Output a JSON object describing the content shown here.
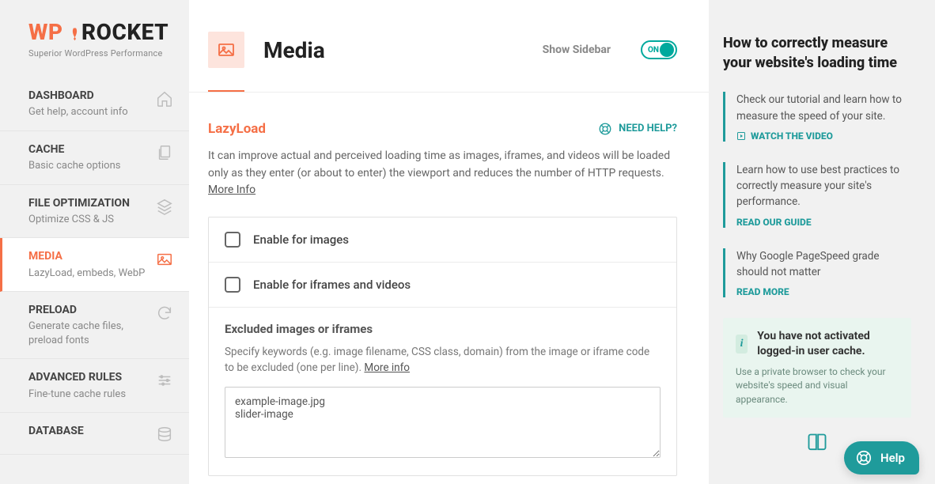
{
  "logo": {
    "prefix": "WP",
    "suffix": "ROCKET",
    "tagline": "Superior WordPress Performance"
  },
  "nav": [
    {
      "title": "DASHBOARD",
      "sub": "Get help, account info",
      "icon": "home"
    },
    {
      "title": "CACHE",
      "sub": "Basic cache options",
      "icon": "copy"
    },
    {
      "title": "FILE OPTIMIZATION",
      "sub": "Optimize CSS & JS",
      "icon": "layers"
    },
    {
      "title": "MEDIA",
      "sub": "LazyLoad, embeds, WebP",
      "icon": "image",
      "active": true
    },
    {
      "title": "PRELOAD",
      "sub": "Generate cache files, preload fonts",
      "icon": "refresh"
    },
    {
      "title": "ADVANCED RULES",
      "sub": "Fine-tune cache rules",
      "icon": "sliders"
    },
    {
      "title": "DATABASE",
      "sub": "",
      "icon": "database"
    }
  ],
  "header": {
    "title": "Media",
    "show_sidebar_label": "Show Sidebar",
    "toggle_on": "ON"
  },
  "section": {
    "title": "LazyLoad",
    "need_help": "NEED HELP?",
    "desc": "It can improve actual and perceived loading time as images, iframes, and videos will be loaded only as they enter (or about to enter) the viewport and reduces the number of HTTP requests.",
    "more_info": "More Info"
  },
  "options": {
    "enable_images": "Enable for images",
    "enable_iframes": "Enable for iframes and videos",
    "excluded_title": "Excluded images or iframes",
    "excluded_desc": "Specify keywords (e.g. image filename, CSS class, domain) from the image or iframe code to be excluded (one per line).",
    "excluded_more": "More info",
    "excluded_value": "example-image.jpg\nslider-image"
  },
  "right": {
    "title": "How to correctly measure your website's loading time",
    "tips": [
      {
        "text": "Check our tutorial and learn how to measure the speed of your site.",
        "link": "WATCH THE VIDEO",
        "icon": true
      },
      {
        "text": "Learn how to use best practices to correctly measure your site's performance.",
        "link": "READ OUR GUIDE",
        "icon": false
      },
      {
        "text": "Why Google PageSpeed grade should not matter",
        "link": "READ MORE",
        "icon": false
      }
    ],
    "notice_title": "You have not activated logged-in user cache.",
    "notice_text": "Use a private browser to check your website's speed and visual appearance."
  },
  "help_fab": "Help"
}
